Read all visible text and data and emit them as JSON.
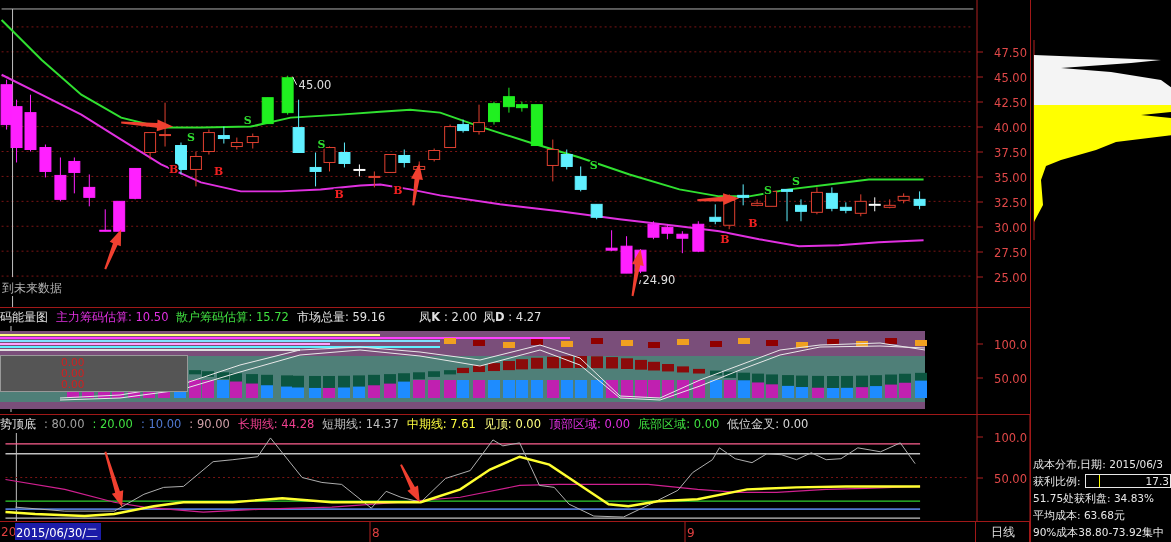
{
  "price_pane": {
    "axis_labels": [
      "47.50",
      "45.00",
      "42.50",
      "40.00",
      "37.50",
      "35.00",
      "32.50",
      "30.00",
      "27.50",
      "25.00"
    ],
    "price_labels": [
      {
        "text": "45.00"
      },
      {
        "text": "24.90"
      }
    ],
    "signals": [
      {
        "kind": "sell",
        "text": "S"
      },
      {
        "kind": "sell",
        "text": "S"
      },
      {
        "kind": "sell",
        "text": "S"
      },
      {
        "kind": "sell",
        "text": "S"
      },
      {
        "kind": "sell",
        "text": "S"
      },
      {
        "kind": "sell",
        "text": "S"
      },
      {
        "kind": "buy",
        "text": "B"
      },
      {
        "kind": "buy",
        "text": "B"
      },
      {
        "kind": "buy",
        "text": "B"
      },
      {
        "kind": "buy",
        "text": "B"
      },
      {
        "kind": "buy",
        "text": "B"
      },
      {
        "kind": "buy",
        "text": "B"
      }
    ],
    "note": "到未来数据"
  },
  "energy_pane": {
    "title": "码能量图",
    "readouts": [
      {
        "text": "主力筹码估算: 10.50",
        "color": "#e030e0"
      },
      {
        "text": "散户筹码估算: 15.72",
        "color": "#40e040"
      },
      {
        "text": "市场总量: 59.16",
        "color": "#e0e0e0"
      }
    ],
    "kd": [
      "凤**K** : 2.00",
      "凤**D** : 4.27"
    ],
    "overlay_values": [
      "0.00",
      "0.00",
      "0.00"
    ],
    "axis_labels": [
      "100.0",
      "50.00"
    ]
  },
  "trend_pane": {
    "title": "势顶底",
    "readouts": [
      {
        "text": ": 80.00",
        "color": "#a0a0a0"
      },
      {
        "text": ": 20.00",
        "color": "#40e040"
      },
      {
        "text": ": 10.00",
        "color": "#5078d0"
      },
      {
        "text": ": 90.00",
        "color": "#d0a0a8"
      },
      {
        "text": "长期线: 44.28",
        "color": "#f04090"
      },
      {
        "text": "短期线: 14.37",
        "color": "#c0c0c0"
      },
      {
        "text": "中期线: 7.61",
        "color": "#ffff40"
      },
      {
        "text": "见顶: 0.00",
        "color": "#ffff80"
      },
      {
        "text": "顶部区域: 0.00",
        "color": "#e030e0"
      },
      {
        "text": "底部区域: 0.00",
        "color": "#40e040"
      },
      {
        "text": "低位金叉: 0.00",
        "color": "#d8d8d8"
      }
    ],
    "axis_labels": [
      "100.0",
      "50.00"
    ]
  },
  "time_axis": {
    "labels": [
      {
        "kind": "cut",
        "text": "20"
      },
      {
        "kind": "cursor",
        "text": "2015/06/30/二"
      },
      {
        "kind": "month",
        "text": "8"
      },
      {
        "kind": "month",
        "text": "9"
      }
    ],
    "period": "日线"
  },
  "cost_panel": {
    "date_line": "成本分布,日期: 2015/06/3",
    "profit_label": "获利比例:",
    "profit": {
      "level": 0.173,
      "reading": "17.3"
    },
    "lines": [
      "51.75处获利盘: 34.83%",
      "平均成本: 63.68元",
      "90%成本38.80-73.92集中"
    ]
  }
}
